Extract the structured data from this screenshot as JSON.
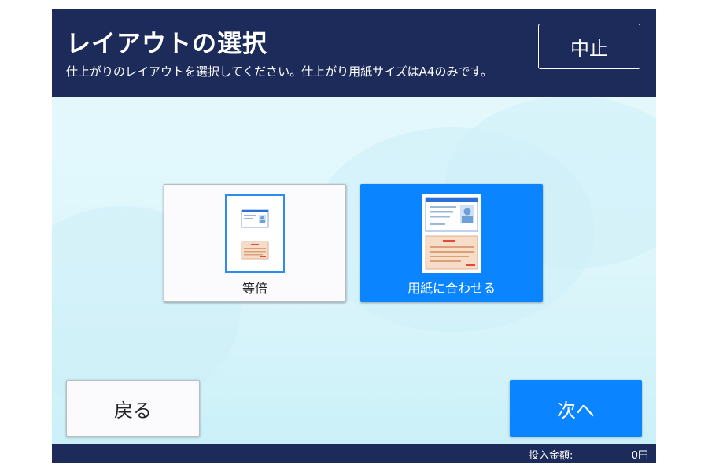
{
  "header": {
    "title": "レイアウトの選択",
    "subtitle": "仕上がりのレイアウトを選択してください。仕上がり用紙サイズはA4のみです。",
    "cancel_label": "中止"
  },
  "options": [
    {
      "label": "等倍",
      "selected": false,
      "icon": "actual-size-layout-icon"
    },
    {
      "label": "用紙に合わせる",
      "selected": true,
      "icon": "fit-to-paper-layout-icon"
    }
  ],
  "nav": {
    "back_label": "戻る",
    "next_label": "次へ"
  },
  "footer": {
    "fee_label": "投入金額:",
    "fee_value": "0円"
  },
  "colors": {
    "header_bg": "#1c2b5a",
    "accent": "#0a84ff",
    "background": "#dff7fc"
  }
}
